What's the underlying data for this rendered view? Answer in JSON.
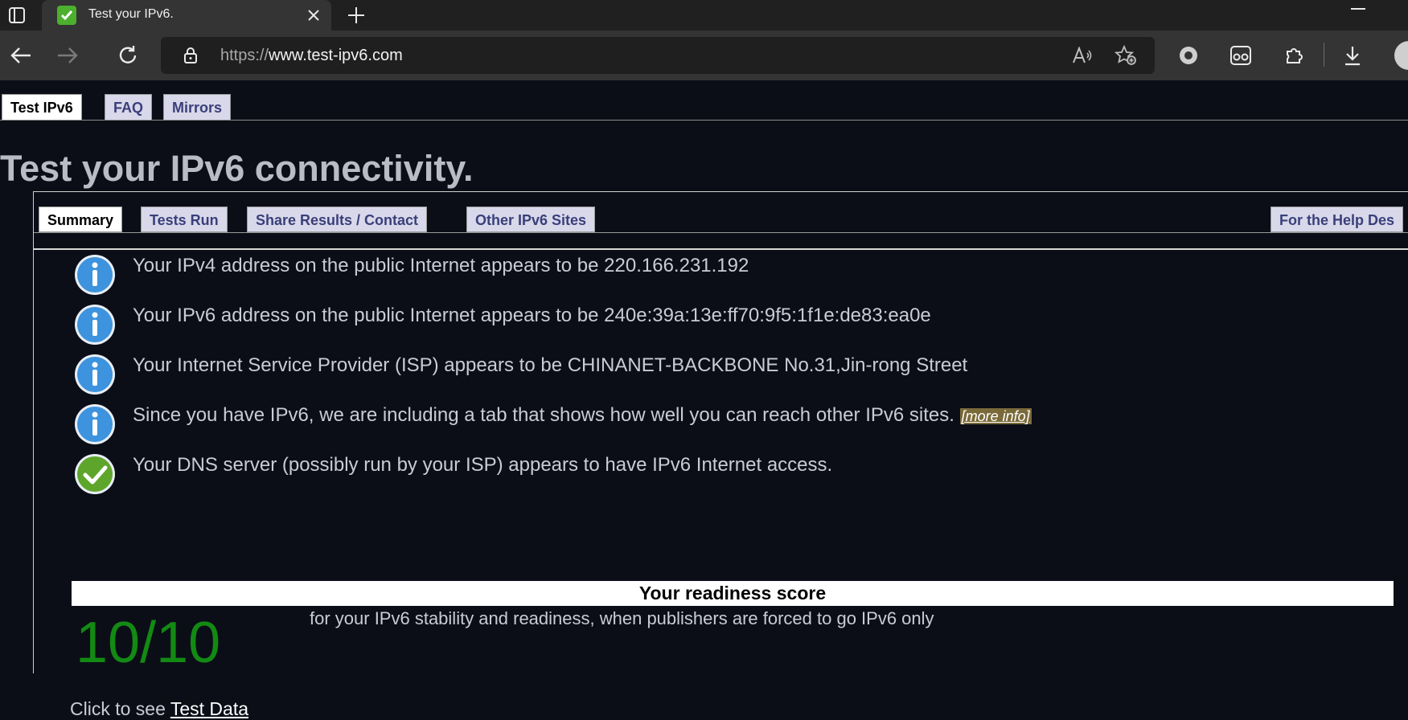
{
  "browser": {
    "tab_title": "Test your IPv6.",
    "url_prefix": "https://",
    "url_host": "www.test-ipv6.com"
  },
  "topnav": [
    {
      "label": "Test IPv6",
      "active": true
    },
    {
      "label": "FAQ",
      "active": false
    },
    {
      "label": "Mirrors",
      "active": false
    }
  ],
  "heading": "Test your IPv6 connectivity.",
  "subtabs": {
    "summary": "Summary",
    "tests_run": "Tests Run",
    "share": "Share Results / Contact",
    "other_sites": "Other IPv6 Sites",
    "help_desk": "For the Help Des"
  },
  "results": [
    {
      "icon": "info",
      "text": "Your IPv4 address on the public Internet appears to be 220.166.231.192"
    },
    {
      "icon": "info",
      "text": "Your IPv6 address on the public Internet appears to be 240e:39a:13e:ff70:9f5:1f1e:de83:ea0e"
    },
    {
      "icon": "info",
      "text": "Your Internet Service Provider (ISP) appears to be CHINANET-BACKBONE No.31,Jin-rong Street"
    },
    {
      "icon": "info",
      "text": "Since you have IPv6, we are including a tab that shows how well you can reach other IPv6 sites.",
      "link": "[more info]"
    },
    {
      "icon": "check",
      "text": "Your DNS server (possibly run by your ISP) appears to have IPv6 Internet access."
    }
  ],
  "readiness": {
    "header": "Your readiness score",
    "score": "10/10",
    "description": "for your IPv6 stability and readiness, when publishers are forced to go IPv6 only"
  },
  "footer": {
    "prefix": "Click to see",
    "link": "Test Data"
  },
  "colors": {
    "page_bg": "#0b0e17",
    "score_green": "#138a13",
    "tab_inactive": "#d8d8ea"
  }
}
